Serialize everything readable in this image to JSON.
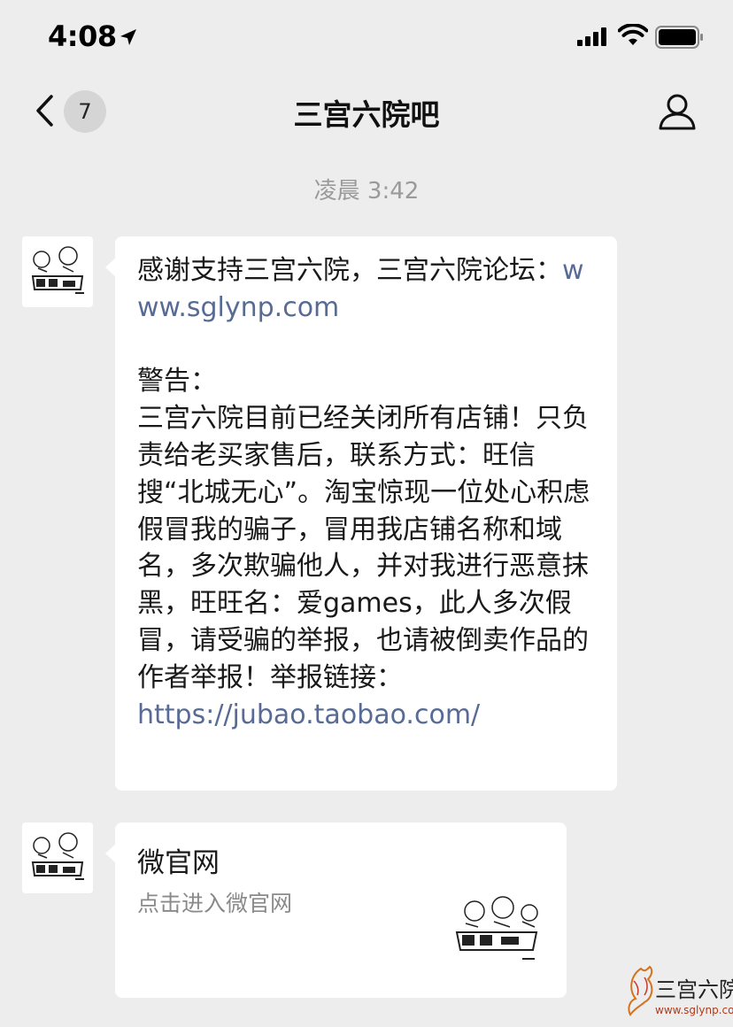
{
  "status_bar": {
    "time": "4:08",
    "icons": [
      "location-arrow-icon",
      "signal-icon",
      "wifi-icon",
      "battery-icon"
    ]
  },
  "nav": {
    "back_icon": "chevron-left-icon",
    "unread_count": "7",
    "title": "三宫六院吧",
    "profile_icon": "person-icon"
  },
  "chat": {
    "timestamp": "凌晨 3:42",
    "messages": [
      {
        "type": "text",
        "text_before_link1": "感谢支持三宫六院，三宫六院论坛：",
        "link1": "www.sglynp.com",
        "text_middle": "\n\n警告：\n三宫六院目前已经关闭所有店铺！只负责给老买家售后，联系方式：旺信搜“北城无心”。淘宝惊现一位处心积虑假冒我的骗子，冒用我店铺名称和域名，多次欺骗他人，并对我进行恶意抹黑，旺旺名：爱games，此人多次假冒，请受骗的举报，也请被倒卖作品的作者举报！举报链接：\n",
        "link2": "https://jubao.taobao.com/"
      },
      {
        "type": "card",
        "title": "微官网",
        "description": "点击进入微官网"
      }
    ]
  },
  "watermark": {
    "text": "三宫六院",
    "url": "www.sglynp.com"
  },
  "colors": {
    "background": "#ededed",
    "bubble": "#ffffff",
    "link": "#576b95",
    "timestamp": "#9a9a9a"
  }
}
